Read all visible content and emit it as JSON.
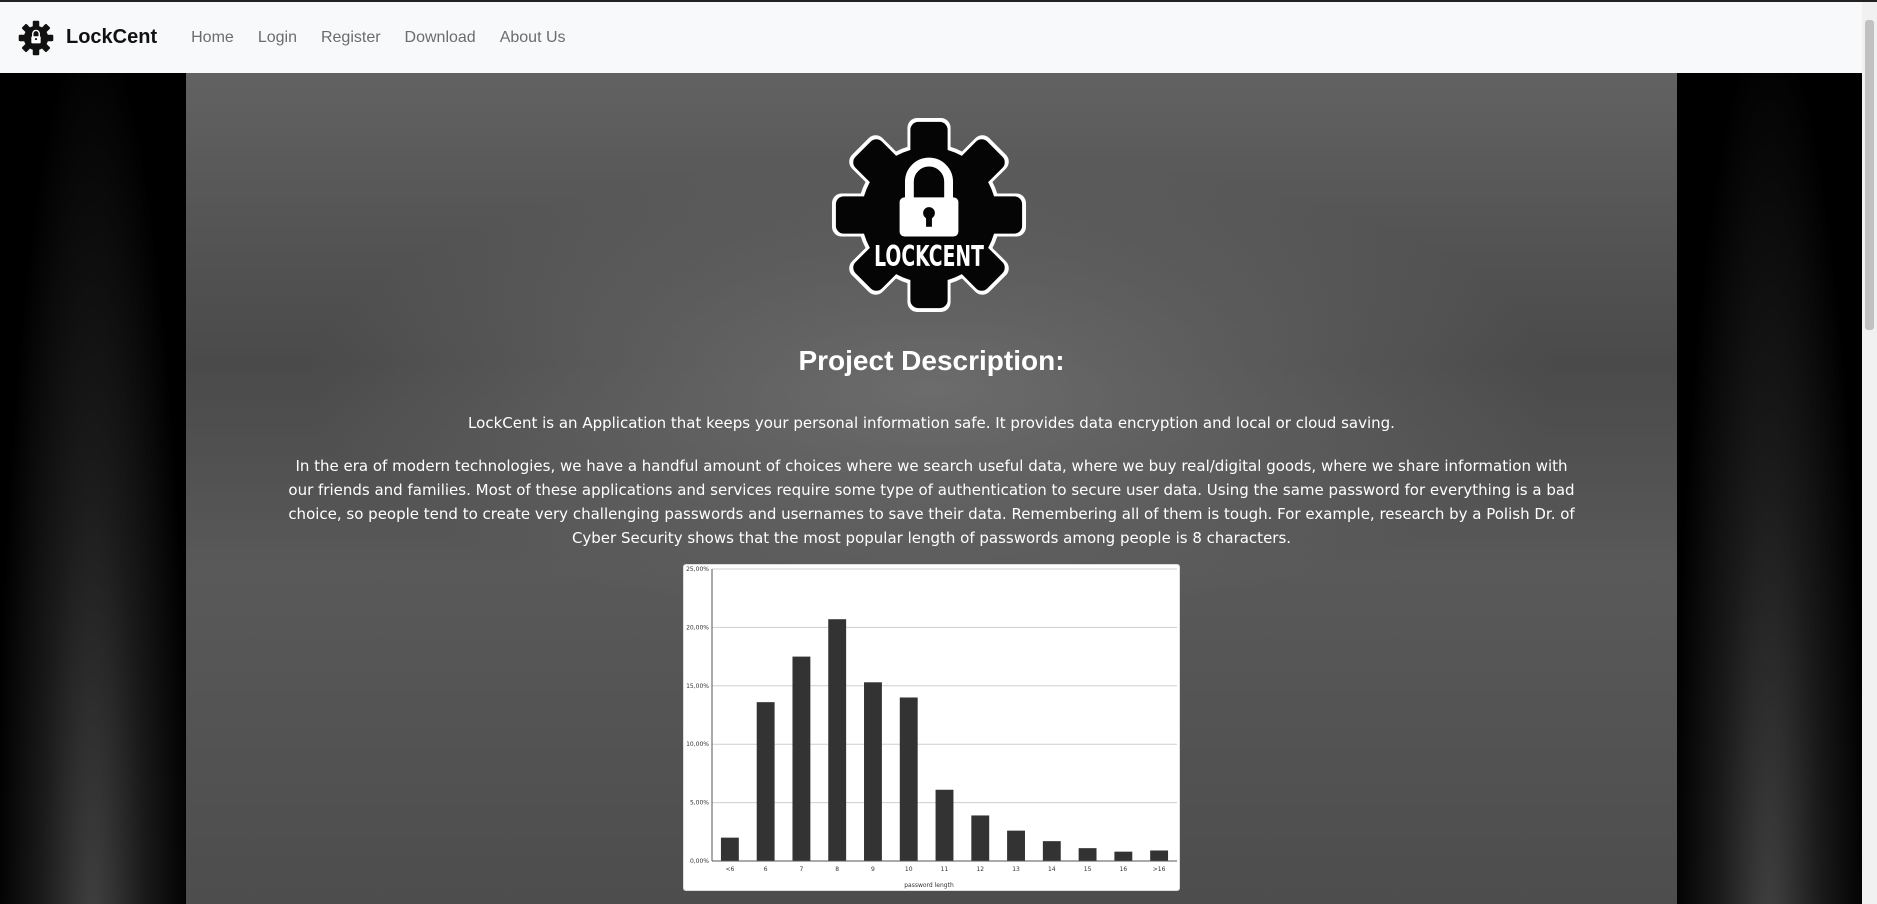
{
  "navbar": {
    "brand": "LockCent",
    "links": [
      "Home",
      "Login",
      "Register",
      "Download",
      "About Us"
    ]
  },
  "hero": {
    "logo_text": "LOCKCENT",
    "title": "Project Description:",
    "paragraph1": "LockCent is an Application that keeps your personal information safe. It provides data encryption and local or cloud saving.",
    "paragraph2": "In the era of modern technologies, we have a handful amount of choices where we search useful data, where we buy real/digital goods, where we share information with our friends and families. Most of these applications and services require some type of authentication to secure user data. Using the same password for everything is a bad choice, so people tend to create very challenging passwords and usernames to save their data. Remembering all of them is tough. For example, research by a Polish Dr. of Cyber Security shows that the most popular length of passwords among people is 8 characters."
  },
  "colors": {
    "navbar_bg": "#f8f9fa",
    "bar_fill": "#333333",
    "text_light": "#ffffff"
  },
  "icons": {
    "brand": "gear-lock-icon",
    "hero": "gear-lock-logo"
  },
  "chart_data": {
    "type": "bar",
    "categories": [
      "<6",
      "6",
      "7",
      "8",
      "9",
      "10",
      "11",
      "12",
      "13",
      "14",
      "15",
      "16",
      ">16"
    ],
    "values": [
      2.0,
      13.6,
      17.5,
      20.7,
      15.3,
      14.0,
      6.1,
      3.9,
      2.6,
      1.7,
      1.1,
      0.8,
      0.9
    ],
    "ytick_labels": [
      "0,00%",
      "5,00%",
      "10,00%",
      "15,00%",
      "20,00%",
      "25,00%"
    ],
    "ylim": [
      0,
      25
    ],
    "xlabel": "password length",
    "ylabel": "",
    "grid": true
  }
}
